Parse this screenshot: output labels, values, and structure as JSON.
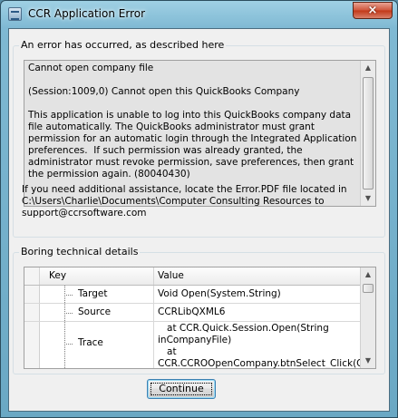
{
  "window": {
    "title": "CCR Application Error",
    "close_glyph": "×"
  },
  "error_group": {
    "legend": "An error has occurred, as described here",
    "message": "Cannot open company file\n\n(Session:1009,0) Cannot open this QuickBooks Company\n\nThis application is unable to log into this QuickBooks company data file automatically. The QuickBooks administrator must grant permission for an automatic login through the Integrated Application preferences.  If such permission was already granted, the administrator must revoke permission, save preferences, then grant the permission again. (80040430)",
    "help_text": "If you need additional assistance, locate the Error.PDF file located in C:\\Users\\Charlie\\Documents\\Computer Consulting Resources to support@ccrsoftware.com"
  },
  "details_group": {
    "legend": "Boring technical details",
    "columns": {
      "key": "Key",
      "value": "Value"
    },
    "rows": [
      {
        "key": "Target",
        "value": "Void Open(System.String)"
      },
      {
        "key": "Source",
        "value": "CCRLibQXML6"
      },
      {
        "key": "Trace",
        "value": "   at CCR.Quick.Session.Open(String\ninCompanyFile)\n   at\nCCR.CCROOpenCompany.btnSelect_Click(Obj"
      }
    ]
  },
  "buttons": {
    "continue": "Continue"
  },
  "icons": {
    "app": "app-window-icon",
    "close": "close-icon",
    "scroll_up": "scroll-up-arrow-icon",
    "scroll_down": "scroll-down-arrow-icon"
  },
  "colors": {
    "title_gradient_top": "#9fd0e4",
    "close_button": "#c23818",
    "button_border": "#3c7fb1"
  }
}
